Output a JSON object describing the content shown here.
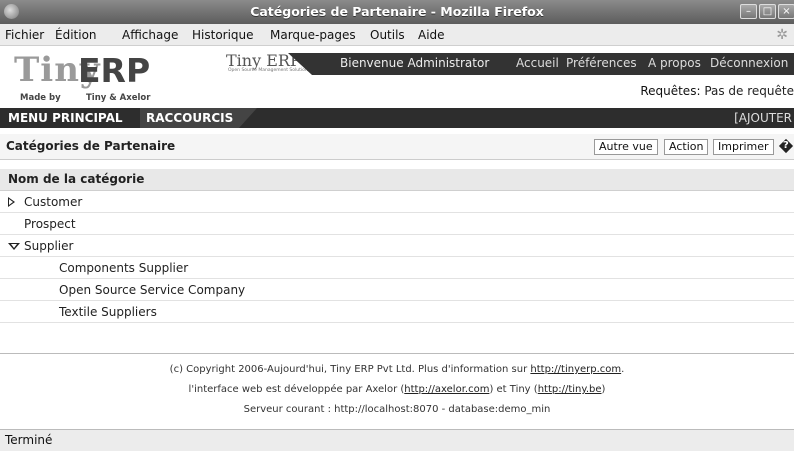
{
  "window": {
    "title": "Catégories de Partenaire - Mozilla Firefox"
  },
  "menubar": [
    "Fichier",
    "Édition",
    "Affichage",
    "Historique",
    "Marque-pages",
    "Outils",
    "Aide"
  ],
  "logo": {
    "big": "Tiny",
    "erp": "ERP",
    "made_by": "Made by",
    "tiny_axelor": "Tiny & Axelor",
    "mini_title": "Tiny ERP",
    "mini_sub": "Open Source Management Solution"
  },
  "topnav": {
    "welcome": "Bienvenue Administrator",
    "links": [
      "Accueil",
      "Préférences",
      "A propos",
      "Déconnexion"
    ]
  },
  "requests": {
    "label": "Requêtes:",
    "value": "Pas de requête"
  },
  "navbar": {
    "main_menu": "MENU PRINCIPAL",
    "shortcuts": "RACCOURCIS",
    "add": "[AJOUTER"
  },
  "page": {
    "title": "Catégories de Partenaire",
    "buttons": [
      "Autre vue",
      "Action",
      "Imprimer"
    ],
    "help": "?"
  },
  "table": {
    "column": "Nom de la catégorie",
    "rows": [
      {
        "label": "Customer"
      },
      {
        "label": "Prospect"
      },
      {
        "label": "Supplier"
      },
      {
        "label": "Components Supplier"
      },
      {
        "label": "Open Source Service Company"
      },
      {
        "label": "Textile Suppliers"
      }
    ]
  },
  "footer": {
    "line1_pre": "(c) Copyright 2006-Aujourd'hui, Tiny ERP Pvt Ltd. Plus d'information sur ",
    "line1_link": "http://tinyerp.com",
    "line1_post": ".",
    "line2_pre": "l'interface web est développée par Axelor (",
    "line2_link1": "http://axelor.com",
    "line2_mid": ") et Tiny (",
    "line2_link2": "http://tiny.be",
    "line2_post": ")",
    "line3": "Serveur courant : http://localhost:8070 - database:demo_min"
  },
  "status": "Terminé"
}
